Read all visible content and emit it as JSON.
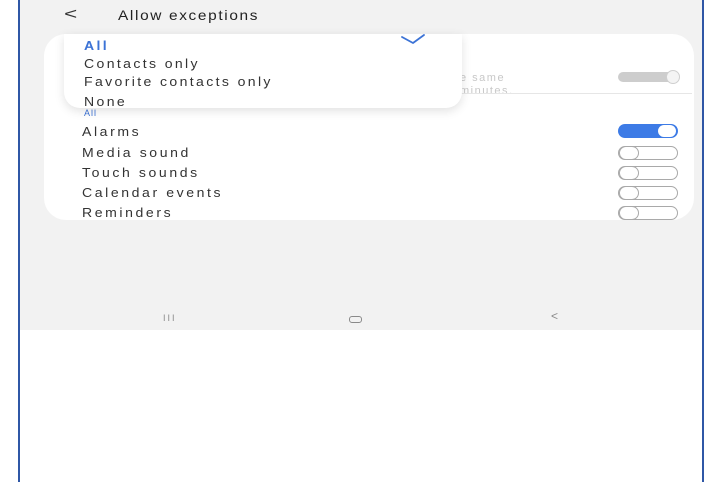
{
  "header": {
    "back_icon": "<",
    "title": "Allow exceptions"
  },
  "dropdown": {
    "options": [
      {
        "label": "All",
        "selected": true
      },
      {
        "label": "Contacts only",
        "selected": false
      },
      {
        "label": "Favorite contacts only",
        "selected": false
      },
      {
        "label": "None",
        "selected": false
      }
    ],
    "check_icon": "check-icon"
  },
  "background_row": {
    "line1": "e same",
    "line2": "minutes.",
    "toggle_on": false
  },
  "calls_from_value": "All",
  "exceptions": [
    {
      "label": "Alarms",
      "on": true
    },
    {
      "label": "Media sound",
      "on": false
    },
    {
      "label": "Touch sounds",
      "on": false
    },
    {
      "label": "Calendar events",
      "on": false
    },
    {
      "label": "Reminders",
      "on": false
    }
  ],
  "navbar": {
    "recent_icon": "III",
    "home_icon": "home-icon",
    "back_icon": "<"
  },
  "colors": {
    "accent": "#3d7be6",
    "selected_text": "#3c73d6",
    "screen_bg": "#f2f2f2",
    "frame_border": "#2f57a6"
  }
}
